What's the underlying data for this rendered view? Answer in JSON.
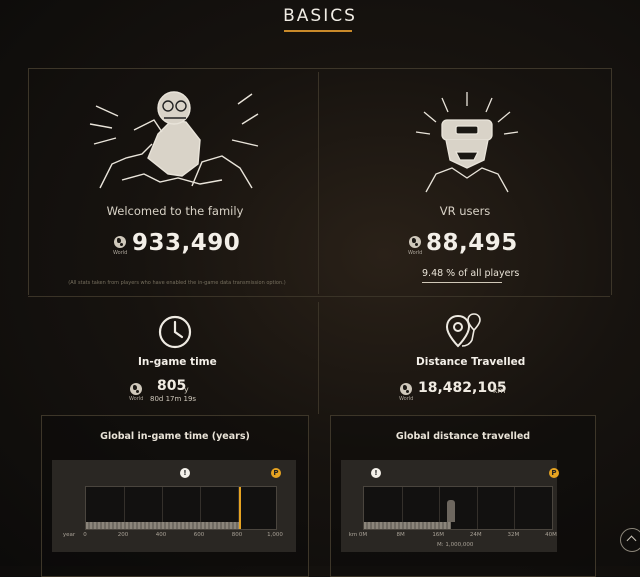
{
  "header": {
    "title": "BASICS"
  },
  "welcome": {
    "caption": "Welcomed to the family",
    "value": "933,490",
    "world_label": "World",
    "note": "(All stats taken from players who have enabled the in-game data transmission option.)"
  },
  "vr": {
    "caption": "VR users",
    "value": "88,495",
    "world_label": "World",
    "percent_text": "9.48 % of all players"
  },
  "time": {
    "label": "In-game time",
    "years": "805",
    "years_unit": "y",
    "detail": "80d 17m 19s",
    "world_label": "World"
  },
  "distance": {
    "label": "Distance Travelled",
    "value": "18,482,105",
    "unit": "km",
    "world_label": "World"
  },
  "chart_data": [
    {
      "type": "bar",
      "title": "Global in-game time (years)",
      "axis_label": "year",
      "ticks": [
        "0",
        "200",
        "400",
        "600",
        "800",
        "1,000"
      ],
      "xlim": [
        0,
        1000
      ],
      "value": 805,
      "marker_color": "#e6a321"
    },
    {
      "type": "bar",
      "title": "Global distance travelled",
      "axis_label": "km",
      "ticks": [
        "0M",
        "8M",
        "16M",
        "24M",
        "32M",
        "40M"
      ],
      "xlim": [
        0,
        40
      ],
      "value": 18.48,
      "footnote": "M: 1,000,000"
    }
  ],
  "icons": {
    "welcome_art": "zombie-illustration-icon",
    "vr_art": "vr-headset-illustration-icon",
    "time": "clock-icon",
    "distance": "map-pins-icon",
    "globe": "globe-icon",
    "scroll": "chevron-up-icon"
  }
}
